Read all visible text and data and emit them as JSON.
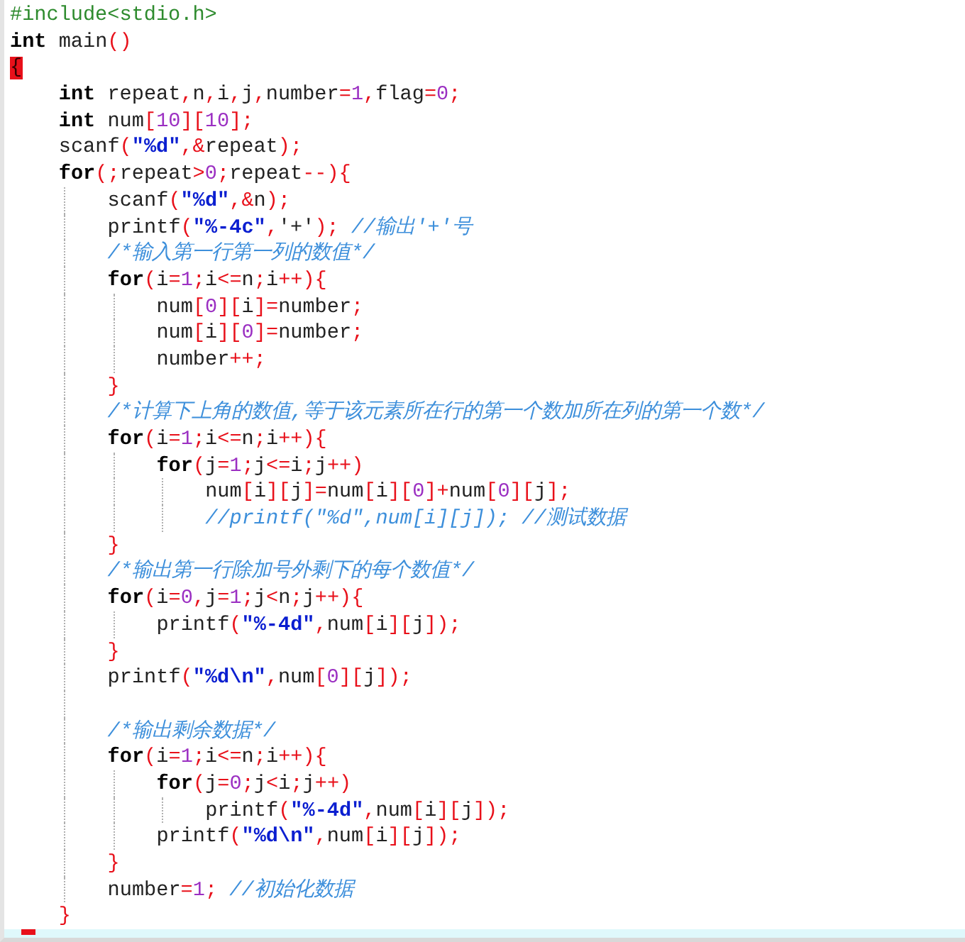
{
  "editor": {
    "lines": [
      {
        "tokens": [
          {
            "kind": "pp",
            "text": "#include<stdio.h>"
          }
        ]
      },
      {
        "tokens": [
          {
            "kind": "kw",
            "text": "int"
          },
          {
            "kind": "id",
            "text": " main"
          },
          {
            "kind": "op",
            "text": "()"
          }
        ]
      },
      {
        "tokens": [
          {
            "kind": "match",
            "text": "{"
          }
        ]
      },
      {
        "tokens": [
          {
            "kind": "kw",
            "text": "    int"
          },
          {
            "kind": "id",
            "text": " repeat"
          },
          {
            "kind": "op",
            "text": ","
          },
          {
            "kind": "id",
            "text": "n"
          },
          {
            "kind": "op",
            "text": ","
          },
          {
            "kind": "id",
            "text": "i"
          },
          {
            "kind": "op",
            "text": ","
          },
          {
            "kind": "id",
            "text": "j"
          },
          {
            "kind": "op",
            "text": ","
          },
          {
            "kind": "id",
            "text": "number"
          },
          {
            "kind": "op",
            "text": "="
          },
          {
            "kind": "num",
            "text": "1"
          },
          {
            "kind": "op",
            "text": ","
          },
          {
            "kind": "id",
            "text": "flag"
          },
          {
            "kind": "op",
            "text": "="
          },
          {
            "kind": "num",
            "text": "0"
          },
          {
            "kind": "op",
            "text": ";"
          }
        ]
      },
      {
        "tokens": [
          {
            "kind": "kw",
            "text": "    int"
          },
          {
            "kind": "id",
            "text": " num"
          },
          {
            "kind": "op",
            "text": "["
          },
          {
            "kind": "num",
            "text": "10"
          },
          {
            "kind": "op",
            "text": "]["
          },
          {
            "kind": "num",
            "text": "10"
          },
          {
            "kind": "op",
            "text": "];"
          }
        ]
      },
      {
        "tokens": [
          {
            "kind": "id",
            "text": "    scanf"
          },
          {
            "kind": "op",
            "text": "("
          },
          {
            "kind": "str",
            "text": "\"%d\""
          },
          {
            "kind": "op",
            "text": ",&"
          },
          {
            "kind": "id",
            "text": "repeat"
          },
          {
            "kind": "op",
            "text": ");"
          }
        ]
      },
      {
        "tokens": [
          {
            "kind": "kw",
            "text": "    for"
          },
          {
            "kind": "op",
            "text": "(;"
          },
          {
            "kind": "id",
            "text": "repeat"
          },
          {
            "kind": "op",
            "text": ">"
          },
          {
            "kind": "num",
            "text": "0"
          },
          {
            "kind": "op",
            "text": ";"
          },
          {
            "kind": "id",
            "text": "repeat"
          },
          {
            "kind": "op",
            "text": "--){"
          }
        ]
      },
      {
        "tokens": [
          {
            "kind": "id",
            "text": "        scanf"
          },
          {
            "kind": "op",
            "text": "("
          },
          {
            "kind": "str",
            "text": "\"%d\""
          },
          {
            "kind": "op",
            "text": ",&"
          },
          {
            "kind": "id",
            "text": "n"
          },
          {
            "kind": "op",
            "text": ");"
          }
        ]
      },
      {
        "tokens": [
          {
            "kind": "id",
            "text": "        printf"
          },
          {
            "kind": "op",
            "text": "("
          },
          {
            "kind": "str",
            "text": "\"%-4c\""
          },
          {
            "kind": "op",
            "text": ","
          },
          {
            "kind": "id",
            "text": "'+'"
          },
          {
            "kind": "op",
            "text": ");"
          },
          {
            "kind": "cmt",
            "text": " //输出'+'号"
          }
        ]
      },
      {
        "tokens": [
          {
            "kind": "cmt",
            "text": "        /*输入第一行第一列的数值*/"
          }
        ]
      },
      {
        "tokens": [
          {
            "kind": "kw",
            "text": "        for"
          },
          {
            "kind": "op",
            "text": "("
          },
          {
            "kind": "id",
            "text": "i"
          },
          {
            "kind": "op",
            "text": "="
          },
          {
            "kind": "num",
            "text": "1"
          },
          {
            "kind": "op",
            "text": ";"
          },
          {
            "kind": "id",
            "text": "i"
          },
          {
            "kind": "op",
            "text": "<="
          },
          {
            "kind": "id",
            "text": "n"
          },
          {
            "kind": "op",
            "text": ";"
          },
          {
            "kind": "id",
            "text": "i"
          },
          {
            "kind": "op",
            "text": "++){"
          }
        ]
      },
      {
        "tokens": [
          {
            "kind": "id",
            "text": "            num"
          },
          {
            "kind": "op",
            "text": "["
          },
          {
            "kind": "num",
            "text": "0"
          },
          {
            "kind": "op",
            "text": "]["
          },
          {
            "kind": "id",
            "text": "i"
          },
          {
            "kind": "op",
            "text": "]="
          },
          {
            "kind": "id",
            "text": "number"
          },
          {
            "kind": "op",
            "text": ";"
          }
        ]
      },
      {
        "tokens": [
          {
            "kind": "id",
            "text": "            num"
          },
          {
            "kind": "op",
            "text": "["
          },
          {
            "kind": "id",
            "text": "i"
          },
          {
            "kind": "op",
            "text": "]["
          },
          {
            "kind": "num",
            "text": "0"
          },
          {
            "kind": "op",
            "text": "]="
          },
          {
            "kind": "id",
            "text": "number"
          },
          {
            "kind": "op",
            "text": ";"
          }
        ]
      },
      {
        "tokens": [
          {
            "kind": "id",
            "text": "            number"
          },
          {
            "kind": "op",
            "text": "++;"
          }
        ]
      },
      {
        "tokens": [
          {
            "kind": "op",
            "text": "        }"
          }
        ]
      },
      {
        "tokens": [
          {
            "kind": "cmt",
            "text": "        /*计算下上角的数值,等于该元素所在行的第一个数加所在列的第一个数*/"
          }
        ]
      },
      {
        "tokens": [
          {
            "kind": "kw",
            "text": "        for"
          },
          {
            "kind": "op",
            "text": "("
          },
          {
            "kind": "id",
            "text": "i"
          },
          {
            "kind": "op",
            "text": "="
          },
          {
            "kind": "num",
            "text": "1"
          },
          {
            "kind": "op",
            "text": ";"
          },
          {
            "kind": "id",
            "text": "i"
          },
          {
            "kind": "op",
            "text": "<="
          },
          {
            "kind": "id",
            "text": "n"
          },
          {
            "kind": "op",
            "text": ";"
          },
          {
            "kind": "id",
            "text": "i"
          },
          {
            "kind": "op",
            "text": "++){"
          }
        ]
      },
      {
        "tokens": [
          {
            "kind": "kw",
            "text": "            for"
          },
          {
            "kind": "op",
            "text": "("
          },
          {
            "kind": "id",
            "text": "j"
          },
          {
            "kind": "op",
            "text": "="
          },
          {
            "kind": "num",
            "text": "1"
          },
          {
            "kind": "op",
            "text": ";"
          },
          {
            "kind": "id",
            "text": "j"
          },
          {
            "kind": "op",
            "text": "<="
          },
          {
            "kind": "id",
            "text": "i"
          },
          {
            "kind": "op",
            "text": ";"
          },
          {
            "kind": "id",
            "text": "j"
          },
          {
            "kind": "op",
            "text": "++)"
          }
        ]
      },
      {
        "tokens": [
          {
            "kind": "id",
            "text": "                num"
          },
          {
            "kind": "op",
            "text": "["
          },
          {
            "kind": "id",
            "text": "i"
          },
          {
            "kind": "op",
            "text": "]["
          },
          {
            "kind": "id",
            "text": "j"
          },
          {
            "kind": "op",
            "text": "]="
          },
          {
            "kind": "id",
            "text": "num"
          },
          {
            "kind": "op",
            "text": "["
          },
          {
            "kind": "id",
            "text": "i"
          },
          {
            "kind": "op",
            "text": "]["
          },
          {
            "kind": "num",
            "text": "0"
          },
          {
            "kind": "op",
            "text": "]+"
          },
          {
            "kind": "id",
            "text": "num"
          },
          {
            "kind": "op",
            "text": "["
          },
          {
            "kind": "num",
            "text": "0"
          },
          {
            "kind": "op",
            "text": "]["
          },
          {
            "kind": "id",
            "text": "j"
          },
          {
            "kind": "op",
            "text": "];"
          }
        ]
      },
      {
        "tokens": [
          {
            "kind": "cmt",
            "text": "                //printf(\"%d\",num[i][j]); //测试数据"
          }
        ]
      },
      {
        "tokens": [
          {
            "kind": "op",
            "text": "        }"
          }
        ]
      },
      {
        "tokens": [
          {
            "kind": "cmt",
            "text": "        /*输出第一行除加号外剩下的每个数值*/"
          }
        ]
      },
      {
        "tokens": [
          {
            "kind": "kw",
            "text": "        for"
          },
          {
            "kind": "op",
            "text": "("
          },
          {
            "kind": "id",
            "text": "i"
          },
          {
            "kind": "op",
            "text": "="
          },
          {
            "kind": "num",
            "text": "0"
          },
          {
            "kind": "op",
            "text": ","
          },
          {
            "kind": "id",
            "text": "j"
          },
          {
            "kind": "op",
            "text": "="
          },
          {
            "kind": "num",
            "text": "1"
          },
          {
            "kind": "op",
            "text": ";"
          },
          {
            "kind": "id",
            "text": "j"
          },
          {
            "kind": "op",
            "text": "<"
          },
          {
            "kind": "id",
            "text": "n"
          },
          {
            "kind": "op",
            "text": ";"
          },
          {
            "kind": "id",
            "text": "j"
          },
          {
            "kind": "op",
            "text": "++){"
          }
        ]
      },
      {
        "tokens": [
          {
            "kind": "id",
            "text": "            printf"
          },
          {
            "kind": "op",
            "text": "("
          },
          {
            "kind": "str",
            "text": "\"%-4d\""
          },
          {
            "kind": "op",
            "text": ","
          },
          {
            "kind": "id",
            "text": "num"
          },
          {
            "kind": "op",
            "text": "["
          },
          {
            "kind": "id",
            "text": "i"
          },
          {
            "kind": "op",
            "text": "]["
          },
          {
            "kind": "id",
            "text": "j"
          },
          {
            "kind": "op",
            "text": "]);"
          }
        ]
      },
      {
        "tokens": [
          {
            "kind": "op",
            "text": "        }"
          }
        ]
      },
      {
        "tokens": [
          {
            "kind": "id",
            "text": "        printf"
          },
          {
            "kind": "op",
            "text": "("
          },
          {
            "kind": "str",
            "text": "\"%d\\n\""
          },
          {
            "kind": "op",
            "text": ","
          },
          {
            "kind": "id",
            "text": "num"
          },
          {
            "kind": "op",
            "text": "["
          },
          {
            "kind": "num",
            "text": "0"
          },
          {
            "kind": "op",
            "text": "]["
          },
          {
            "kind": "id",
            "text": "j"
          },
          {
            "kind": "op",
            "text": "]);"
          }
        ]
      },
      {
        "blank": true
      },
      {
        "tokens": [
          {
            "kind": "cmt",
            "text": "        /*输出剩余数据*/"
          }
        ]
      },
      {
        "tokens": [
          {
            "kind": "kw",
            "text": "        for"
          },
          {
            "kind": "op",
            "text": "("
          },
          {
            "kind": "id",
            "text": "i"
          },
          {
            "kind": "op",
            "text": "="
          },
          {
            "kind": "num",
            "text": "1"
          },
          {
            "kind": "op",
            "text": ";"
          },
          {
            "kind": "id",
            "text": "i"
          },
          {
            "kind": "op",
            "text": "<="
          },
          {
            "kind": "id",
            "text": "n"
          },
          {
            "kind": "op",
            "text": ";"
          },
          {
            "kind": "id",
            "text": "i"
          },
          {
            "kind": "op",
            "text": "++){"
          }
        ]
      },
      {
        "tokens": [
          {
            "kind": "kw",
            "text": "            for"
          },
          {
            "kind": "op",
            "text": "("
          },
          {
            "kind": "id",
            "text": "j"
          },
          {
            "kind": "op",
            "text": "="
          },
          {
            "kind": "num",
            "text": "0"
          },
          {
            "kind": "op",
            "text": ";"
          },
          {
            "kind": "id",
            "text": "j"
          },
          {
            "kind": "op",
            "text": "<"
          },
          {
            "kind": "id",
            "text": "i"
          },
          {
            "kind": "op",
            "text": ";"
          },
          {
            "kind": "id",
            "text": "j"
          },
          {
            "kind": "op",
            "text": "++)"
          }
        ]
      },
      {
        "tokens": [
          {
            "kind": "id",
            "text": "                printf"
          },
          {
            "kind": "op",
            "text": "("
          },
          {
            "kind": "str",
            "text": "\"%-4d\""
          },
          {
            "kind": "op",
            "text": ","
          },
          {
            "kind": "id",
            "text": "num"
          },
          {
            "kind": "op",
            "text": "["
          },
          {
            "kind": "id",
            "text": "i"
          },
          {
            "kind": "op",
            "text": "]["
          },
          {
            "kind": "id",
            "text": "j"
          },
          {
            "kind": "op",
            "text": "]);"
          }
        ]
      },
      {
        "tokens": [
          {
            "kind": "id",
            "text": "            printf"
          },
          {
            "kind": "op",
            "text": "("
          },
          {
            "kind": "str",
            "text": "\"%d\\n\""
          },
          {
            "kind": "op",
            "text": ","
          },
          {
            "kind": "id",
            "text": "num"
          },
          {
            "kind": "op",
            "text": "["
          },
          {
            "kind": "id",
            "text": "i"
          },
          {
            "kind": "op",
            "text": "]["
          },
          {
            "kind": "id",
            "text": "j"
          },
          {
            "kind": "op",
            "text": "]);"
          }
        ]
      },
      {
        "tokens": [
          {
            "kind": "op",
            "text": "        }"
          }
        ]
      },
      {
        "tokens": [
          {
            "kind": "id",
            "text": "        number"
          },
          {
            "kind": "op",
            "text": "="
          },
          {
            "kind": "num",
            "text": "1"
          },
          {
            "kind": "op",
            "text": ";"
          },
          {
            "kind": "cmt",
            "text": " //初始化数据"
          }
        ]
      },
      {
        "tokens": [
          {
            "kind": "op",
            "text": "    }"
          }
        ]
      }
    ]
  }
}
